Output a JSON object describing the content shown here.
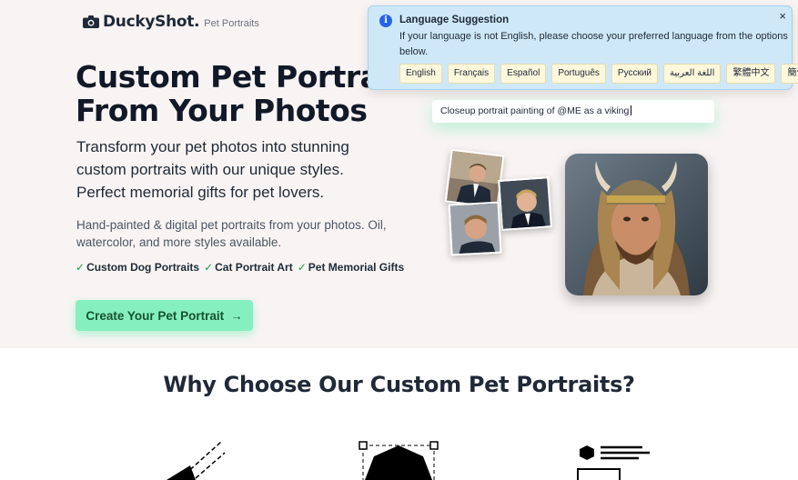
{
  "header": {
    "brand": "DuckyShot.",
    "tagline": "Pet Portraits",
    "logo_icon": "camera-icon"
  },
  "hero": {
    "title_line1": "Custom Pet Portraits",
    "title_line2": "From Your Photos",
    "lead": "Transform your pet photos into stunning custom portraits with our unique styles. Perfect memorial gifts for pet lovers.",
    "description": "Hand-painted & digital pet portraits from your photos. Oil, watercolor, and more styles available.",
    "checks": [
      "Custom Dog Portraits",
      "Cat Portrait Art",
      "Pet Memorial Gifts"
    ],
    "check_glyph": "✓",
    "cta_label": "Create Your Pet Portrait",
    "cta_arrow": "→",
    "prompt_text": "Closeup portrait painting of @ME as a viking"
  },
  "language_banner": {
    "title": "Language Suggestion",
    "message": "If your language is not English, please choose your preferred language from the options below.",
    "close_glyph": "×",
    "info_glyph": "i",
    "languages": [
      "English",
      "Français",
      "Español",
      "Português",
      "Русский",
      "اللغة العربية",
      "繁體中文",
      "簡体中文"
    ]
  },
  "features": {
    "heading": "Why Choose Our Custom Pet Portraits?"
  },
  "colors": {
    "accent": "#86efc0",
    "hero_bg": "#f8f4f3",
    "banner_bg": "#cfe8f7",
    "check": "#16a34a"
  }
}
